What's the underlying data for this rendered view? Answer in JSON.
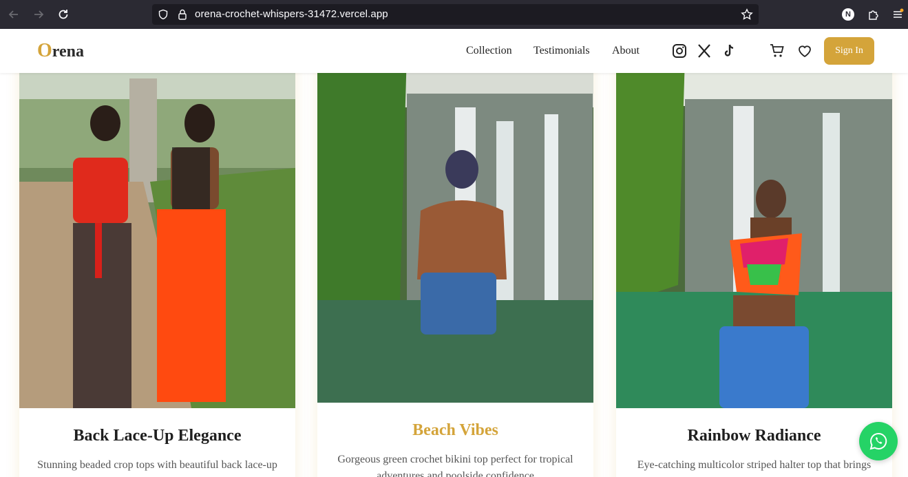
{
  "browser": {
    "url": "orena-crochet-whispers-31472.vercel.app",
    "profile_initial": "N"
  },
  "header": {
    "logo_first": "O",
    "logo_rest": "rena",
    "nav": [
      "Collection",
      "Testimonials",
      "About"
    ],
    "signin_label": "Sign In"
  },
  "colors": {
    "accent": "#d4a43a",
    "whatsapp": "#25d366",
    "chrome": "#2b2a33"
  },
  "cards": [
    {
      "title": "Back Lace-Up Elegance",
      "description": "Stunning beaded crop tops with beautiful back lace-up"
    },
    {
      "title": "Beach Vibes",
      "description": "Gorgeous green crochet bikini top perfect for tropical adventures and poolside confidence"
    },
    {
      "title": "Rainbow Radiance",
      "description": "Eye-catching multicolor striped halter top that brings"
    }
  ]
}
